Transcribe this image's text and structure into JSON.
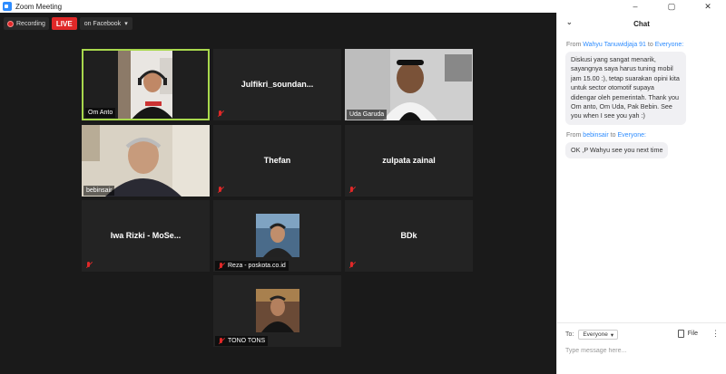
{
  "window": {
    "title": "Zoom Meeting",
    "minimize": "–",
    "maximize": "▢",
    "close": "✕"
  },
  "recording": {
    "label": "Recording",
    "live": "LIVE",
    "stream_target": "on Facebook",
    "dropdown": "▾"
  },
  "participants": [
    {
      "name": "Om Anto",
      "type": "video",
      "active": true
    },
    {
      "name": "Julfikri_soundan...",
      "type": "name",
      "muted": true
    },
    {
      "name": "Uda Garuda",
      "type": "video"
    },
    {
      "name": "bebinsair",
      "type": "video"
    },
    {
      "name": "Thefan",
      "type": "name",
      "muted": true
    },
    {
      "name": "zulpata zainal",
      "type": "name",
      "muted": true
    },
    {
      "name": "Iwa Rizki - MoSe...",
      "type": "name",
      "muted": true
    },
    {
      "name": "Reza - poskota.co.id",
      "type": "photo",
      "muted": true
    },
    {
      "name": "BDk",
      "type": "name",
      "muted": true
    },
    {
      "name": "TONO TONS",
      "type": "photo",
      "muted": true
    }
  ],
  "chat": {
    "title": "Chat",
    "messages": [
      {
        "from_prefix": "From",
        "sender": "Wahyu Tanuwidjaja 91",
        "to_word": "to",
        "recipient": "Everyone:",
        "text": "Diskusi yang sangat menarik, sayangnya saya harus tuning mobil jam 15.00 :), tetap suarakan opini kita untuk sector otomotif supaya didengar oleh pemerintah. Thank you Om anto, Om Uda, Pak Bebin. See you when I see you yah :)"
      },
      {
        "from_prefix": "From",
        "sender": "bebinsair",
        "to_word": "to",
        "recipient": "Everyone:",
        "text": "OK ,P Wahyu see you next time"
      }
    ],
    "to_label": "To:",
    "to_value": "Everyone",
    "file_label": "File",
    "more": "⋮",
    "input_placeholder": "Type message here..."
  },
  "colors": {
    "accent": "#2d8cff",
    "active_speaker": "#a8d84d",
    "live": "#e02828"
  }
}
